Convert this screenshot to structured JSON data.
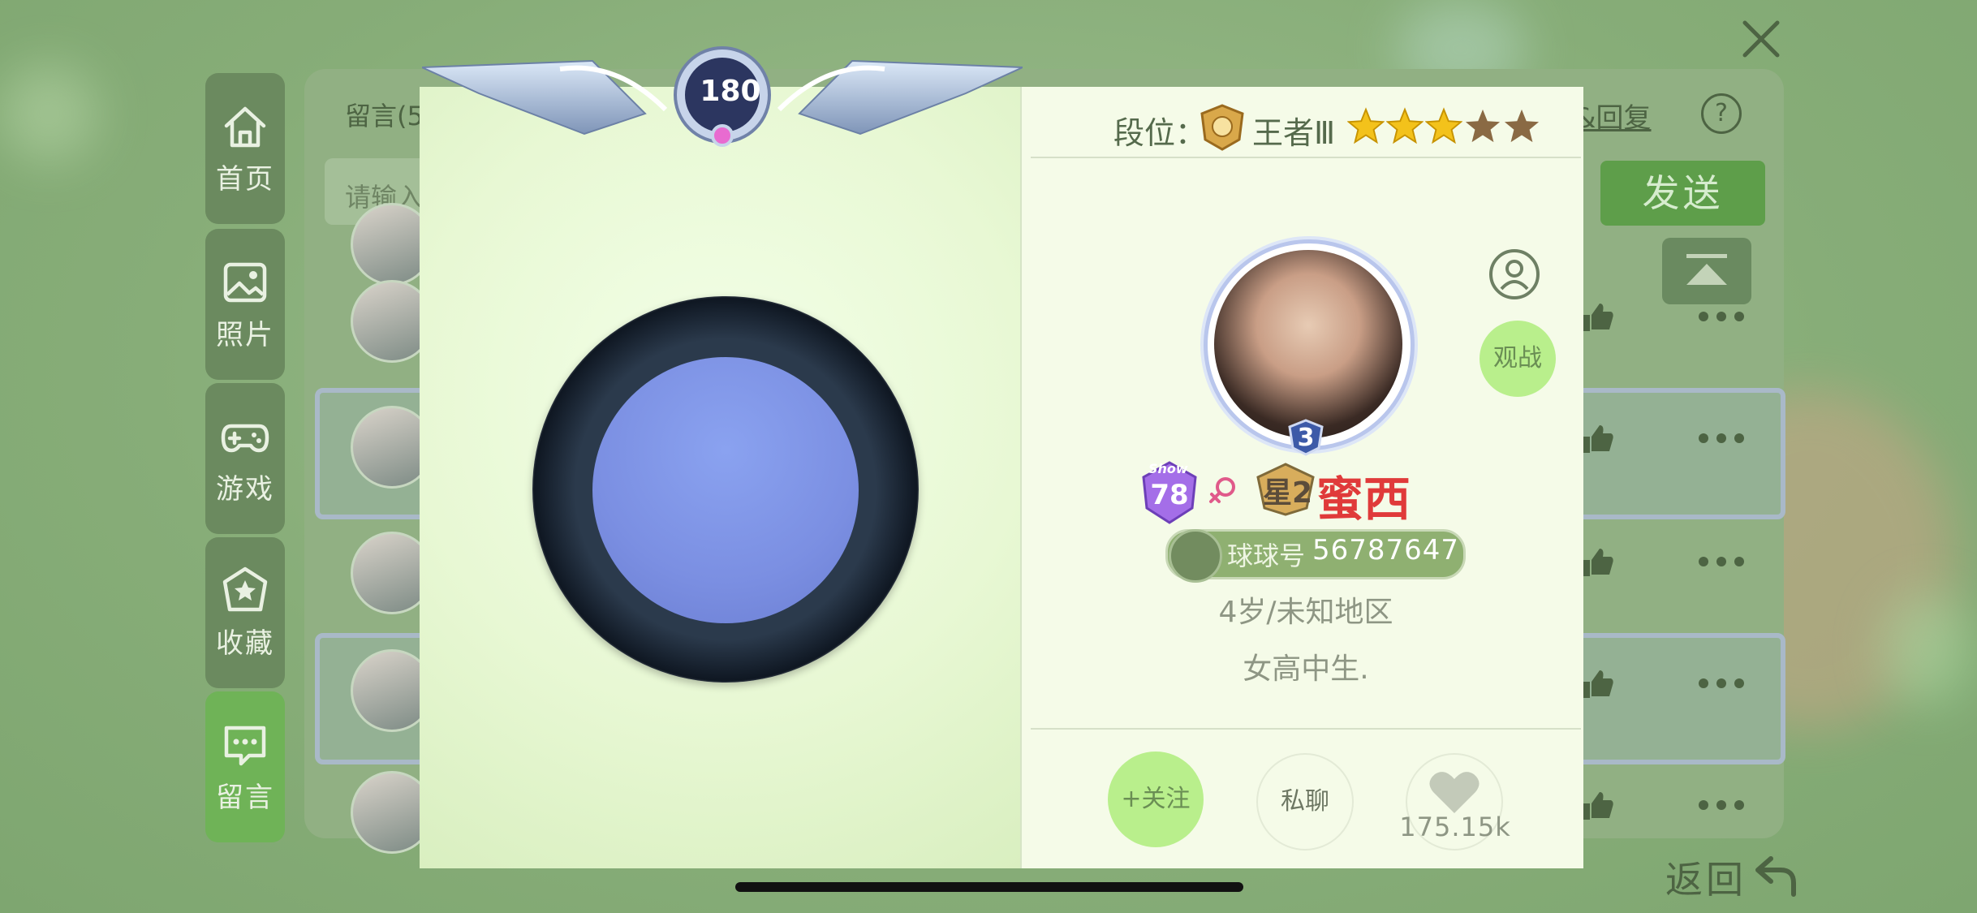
{
  "nav": {
    "items": [
      {
        "label": "首页",
        "icon": "home-icon"
      },
      {
        "label": "照片",
        "icon": "image-icon"
      },
      {
        "label": "游戏",
        "icon": "gamepad-icon"
      },
      {
        "label": "收藏",
        "icon": "star-icon"
      },
      {
        "label": "留言",
        "icon": "message-icon"
      }
    ],
    "active": "留言"
  },
  "background": {
    "tab_label": "留言(5",
    "input_placeholder": "请输入",
    "reply_label": "&回复",
    "send_label": "发送",
    "help_symbol": "?"
  },
  "level": {
    "value": "180"
  },
  "rank": {
    "label": "段位：",
    "name": "王者Ⅲ",
    "stars_total": 5,
    "stars_filled": 3
  },
  "profile": {
    "badge_level": "3",
    "show_level": "78",
    "show_badge_text": "Show",
    "star_badge_text": "星2",
    "nickname": "蜜西",
    "id_label": "球球号",
    "id_number": "56787647",
    "age_region": "4岁/未知地区",
    "signature": "女高中生."
  },
  "actions": {
    "watch_label": "观战",
    "follow_label": "+关注",
    "chat_label": "私聊",
    "like_count": "175.15k"
  },
  "footer": {
    "back_label": "返回"
  },
  "colors": {
    "background": "#87ad78",
    "active_nav": "#6fb357",
    "accent_green": "#b9ef8c",
    "nickname_red": "#e03a3a",
    "star_gold": "#f3c21b",
    "star_empty": "#8a6a44"
  }
}
